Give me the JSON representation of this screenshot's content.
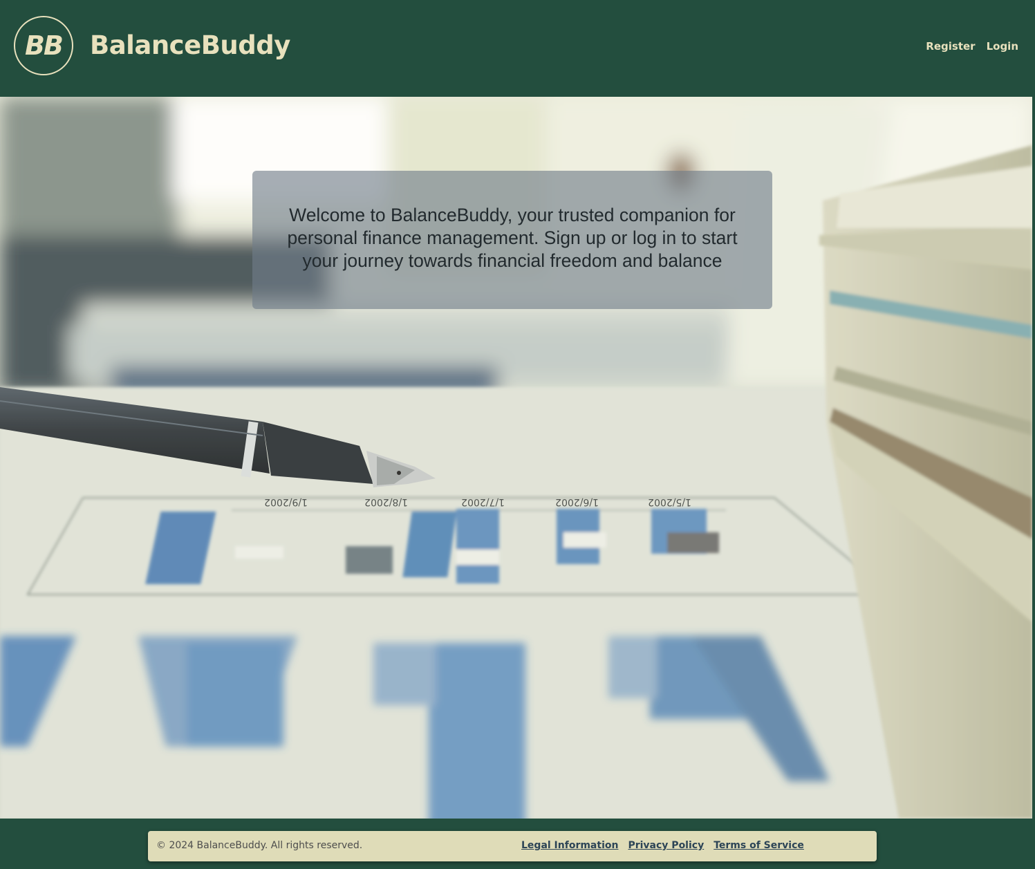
{
  "header": {
    "logo_text": "BB",
    "brand_name": "BalanceBuddy",
    "nav": {
      "register_label": "Register",
      "login_label": "Login"
    }
  },
  "hero": {
    "welcome_text": "Welcome to BalanceBuddy, your trusted companion for personal finance management. Sign up or log in to start your journey towards financial freedom and balance",
    "image_tick_labels": [
      "1/5/2002",
      "1/6/2002",
      "1/7/2002",
      "1/8/2002",
      "1/9/2002"
    ]
  },
  "footer": {
    "copyright": "© 2024 BalanceBuddy. All rights reserved.",
    "links": {
      "legal": "Legal Information",
      "privacy": "Privacy Policy",
      "terms": "Terms of Service"
    }
  },
  "colors": {
    "header_bg": "#234e3e",
    "brand_text": "#e8e1bd",
    "footer_bar_bg": "#dfdcb8",
    "footer_link": "#2c4456",
    "welcome_box_bg": "rgba(112,124,137,0.62)"
  }
}
